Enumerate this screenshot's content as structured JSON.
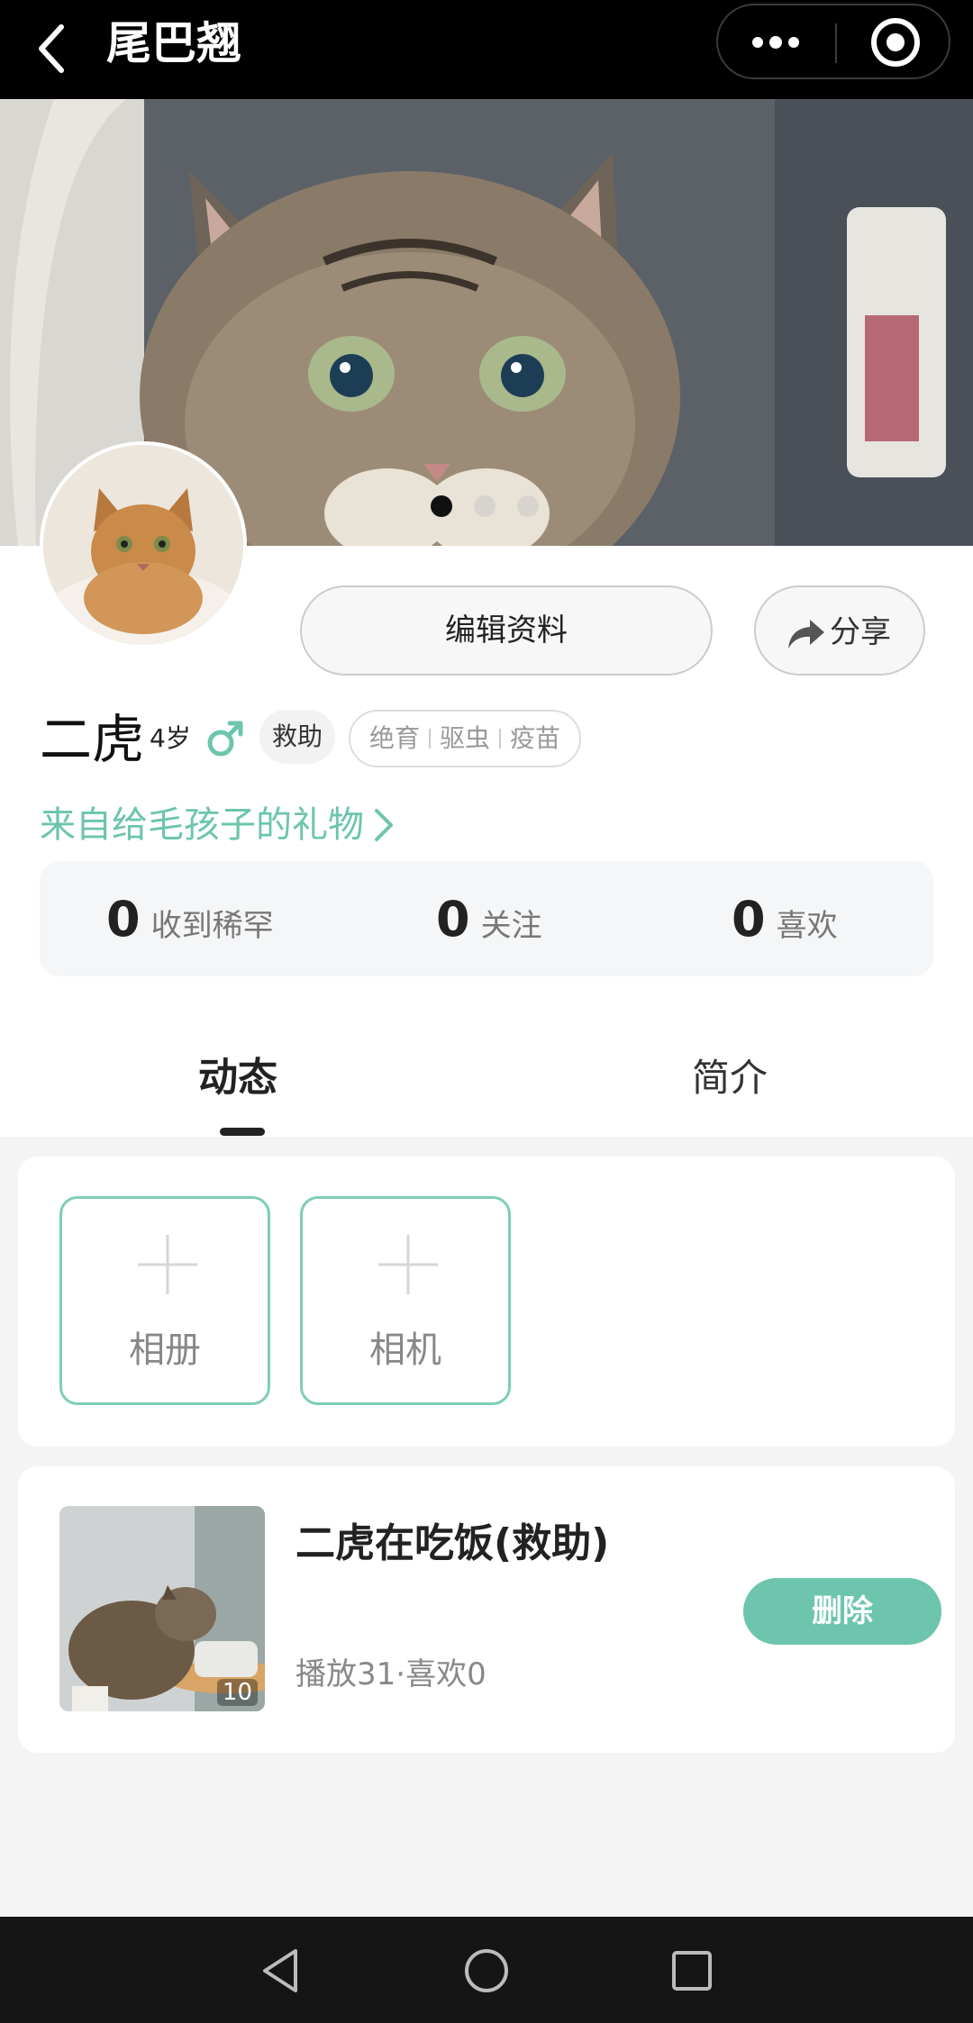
{
  "app_bar": {
    "title": "尾巴翘"
  },
  "cover": {
    "slide_count": 3,
    "active_slide": 0
  },
  "profile": {
    "edit_button": "编辑资料",
    "share_button": "分享",
    "name": "二虎",
    "age": "4岁",
    "gender": "male",
    "tag_rescue": "救助",
    "health_tags": [
      "绝育",
      "驱虫",
      "疫苗"
    ],
    "gift_link": "来自给毛孩子的礼物",
    "stats": [
      {
        "value": "0",
        "label": "收到稀罕"
      },
      {
        "value": "0",
        "label": "关注"
      },
      {
        "value": "0",
        "label": "喜欢"
      }
    ]
  },
  "tabs": {
    "feed": "动态",
    "intro": "简介",
    "active": "feed"
  },
  "upload": {
    "album": "相册",
    "camera": "相机"
  },
  "posts": [
    {
      "title": "二虎在吃饭(救助)",
      "meta": "播放31·喜欢0",
      "thumb_count": "10",
      "delete_label": "删除"
    }
  ],
  "colors": {
    "accent": "#6cc5ac",
    "topbar": "#000000",
    "navbar": "#151515"
  }
}
